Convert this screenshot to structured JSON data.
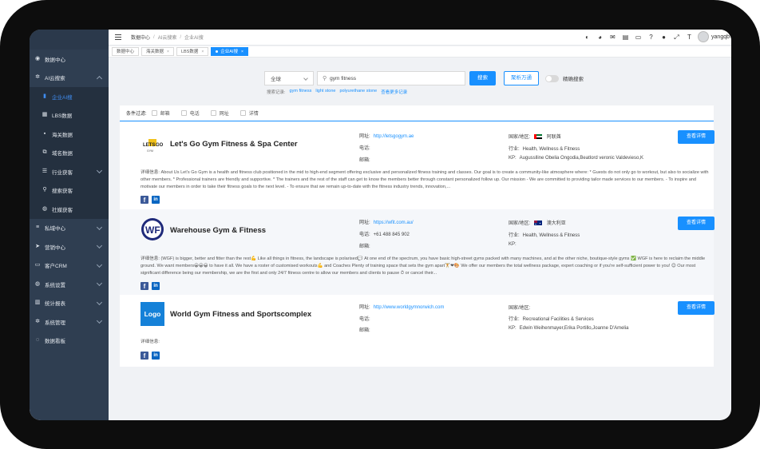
{
  "sidebar": {
    "items": [
      {
        "label": "数据中心",
        "icon": "dashboard-icon"
      },
      {
        "label": "AI云搜索",
        "icon": "gear-icon",
        "expanded": true
      },
      {
        "label": "私域中心",
        "icon": "database-icon"
      },
      {
        "label": "营销中心",
        "icon": "send-icon"
      },
      {
        "label": "客户CRM",
        "icon": "crm-icon"
      },
      {
        "label": "系统设置",
        "icon": "globe-icon"
      },
      {
        "label": "统计报表",
        "icon": "bar-chart-icon"
      },
      {
        "label": "系统管理",
        "icon": "gear-icon"
      },
      {
        "label": "数据看板",
        "icon": "board-icon"
      }
    ],
    "submenu": [
      {
        "label": "企业AI搜",
        "icon": "document-icon",
        "active": true
      },
      {
        "label": "LBS数据",
        "icon": "map-icon"
      },
      {
        "label": "海关数据",
        "icon": "ship-icon"
      },
      {
        "label": "域名数据",
        "icon": "link-icon"
      },
      {
        "label": "行业获客",
        "icon": "list-icon"
      },
      {
        "label": "搜索获客",
        "icon": "search-icon"
      },
      {
        "label": "社媒获客",
        "icon": "globe-icon"
      }
    ]
  },
  "breadcrumb": [
    "数据中心",
    "AI云搜索",
    "企业AI搜"
  ],
  "user": {
    "name": "yangqb"
  },
  "tabs": [
    {
      "label": "数据中心",
      "closable": false
    },
    {
      "label": "海关数据",
      "closable": true
    },
    {
      "label": "LBS数据",
      "closable": true
    },
    {
      "label": "企业AI搜",
      "closable": true,
      "active": true
    }
  ],
  "search": {
    "scope": "全球",
    "query": "gym fitness",
    "search_label": "搜索",
    "bulk_label": "聚析万通",
    "toggle_label": "精确搜索",
    "history_label": "搜索记录:",
    "history": [
      "gym fitness",
      "light stone",
      "polyurethane stone"
    ],
    "history_more": "查看更多记录"
  },
  "filter": {
    "label": "条件过滤:",
    "options": [
      "邮箱",
      "电话",
      "网址",
      "详情"
    ]
  },
  "labels": {
    "website": "网址:",
    "phone": "电话:",
    "email": "邮箱:",
    "country": "国家/地区:",
    "industry": "行业:",
    "kp": "KP:",
    "detail": "详细信息:",
    "view_detail": "查看详情"
  },
  "results": [
    {
      "name": "Let's Go Gym Fitness & Spa Center",
      "logo": "letsgo-logo",
      "website": "http://letsgogym.ae",
      "phone": "",
      "email": "",
      "country": "阿联酋",
      "flag": "uae-flag",
      "industry": "Health, Wellness & Fitness",
      "kp": "Augusslline Obelia Ongodia,Beatlord veronic Valdevieso,K",
      "description": "About Us Let's Go Gym is a health and fitness club positioned in the mid to high-end segment offering exclusive and personalized fitness training and classes. Our goal is to create a community-like atmosphere where: * Guests do not only go to workout, but also to socialize with other members. * Professional trainers are friendly and supportive. * The trainers and the rest of the staff can get to know the members better through constant personalized follow up. Our mission - We are committed to providing tailor made services to our members. - To inspire and motivate our members in order to take their fitness goals to the next level. - To ensure that we remain up-to-date with the fitness industry trends, innovation,..."
    },
    {
      "name": "Warehouse Gym & Fitness",
      "logo": "wf-logo",
      "website": "https://wfit.com.au/",
      "phone": "+61 488 845 902",
      "email": "",
      "country": "澳大利亚",
      "flag": "australia-flag",
      "industry": "Health, Wellness & Fitness",
      "kp": "",
      "description": "(WGF) is bigger, better and fitter than the rest💪 Like all things in fitness, the landscape is polarised💬 At one end of the spectrum, you have basic high-street gyms packed with many machines, and at the other niche, boutique-style gyms ✅ WGF is here to reclaim the middle ground. We want members😀😀😀 to have it all. We have a roster of customised workouts💪 and Coaches Plenty of training space that sets the gym apart🏋❤🎨 We offer our members the total wellness package, expert coaching or if you're self-sufficient power to you! 😊 Our most significant difference being our membership, we are the first and only 24/7 fitness centre to allow our members and clients to pause ⏱ or cancel their..."
    },
    {
      "name": "World Gym Fitness and Sportscomplex",
      "logo": "logo-placeholder",
      "logo_text": "Logo",
      "website": "http://www.worldgymnorwich.com",
      "phone": "",
      "email": "",
      "country": "",
      "flag": "",
      "industry": "Recreational Facilities & Services",
      "kp": "Edwin Weihenmayer,Erika Portillo,Joanne D'Amelia",
      "description": ""
    }
  ],
  "colors": {
    "primary": "#1890ff",
    "sidebar": "#2f3e51",
    "sidebar_sub": "#24303f",
    "page_bg": "#f0f2f5"
  }
}
